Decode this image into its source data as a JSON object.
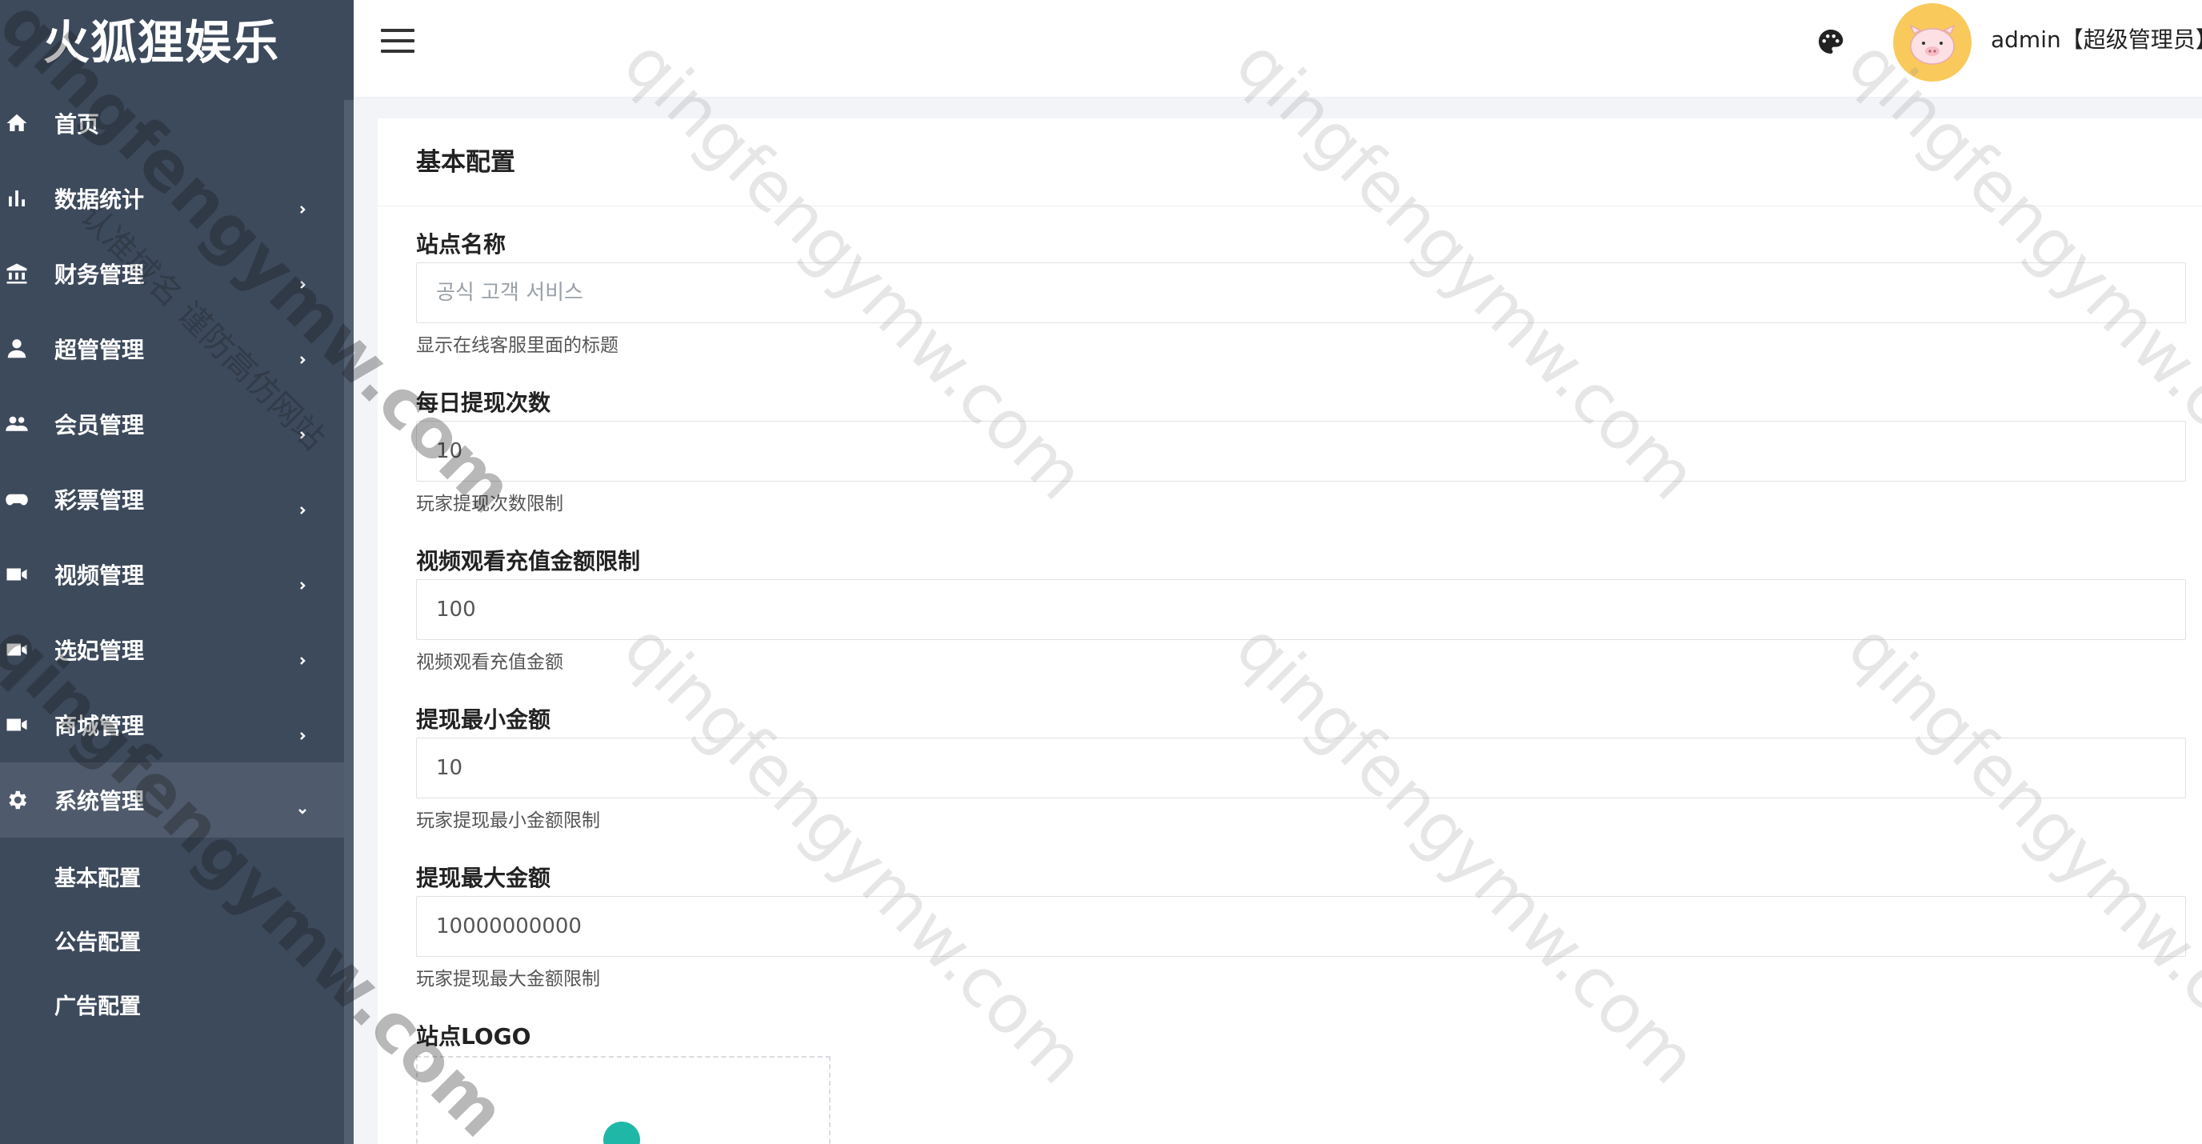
{
  "app": {
    "title": "火狐狸娱乐"
  },
  "sidebar": {
    "items": [
      {
        "label": "首页",
        "icon": "home-icon",
        "has_arrow": false
      },
      {
        "label": "数据统计",
        "icon": "bar-chart-icon",
        "has_arrow": true
      },
      {
        "label": "财务管理",
        "icon": "bank-icon",
        "has_arrow": true
      },
      {
        "label": "超管管理",
        "icon": "user-icon",
        "has_arrow": true
      },
      {
        "label": "会员管理",
        "icon": "users-icon",
        "has_arrow": true
      },
      {
        "label": "彩票管理",
        "icon": "gamepad-icon",
        "has_arrow": true
      },
      {
        "label": "视频管理",
        "icon": "video-icon",
        "has_arrow": true
      },
      {
        "label": "选妃管理",
        "icon": "video-icon",
        "has_arrow": true
      },
      {
        "label": "商城管理",
        "icon": "video-icon",
        "has_arrow": true
      },
      {
        "label": "系统管理",
        "icon": "gear-icon",
        "has_arrow": true,
        "expanded": true
      }
    ],
    "submenu": [
      {
        "label": "基本配置"
      },
      {
        "label": "公告配置"
      },
      {
        "label": "广告配置"
      }
    ]
  },
  "header": {
    "user": "admin【超级管理员】",
    "icons": [
      "hamburger-menu-icon",
      "palette-icon",
      "pig-avatar"
    ]
  },
  "main": {
    "title": "基本配置",
    "fields": [
      {
        "label": "站点名称",
        "value": "",
        "placeholder": "공식 고객 서비스",
        "help": "显示在线客服里面的标题"
      },
      {
        "label": "每日提现次数",
        "value": "10",
        "placeholder": "",
        "help": "玩家提现次数限制"
      },
      {
        "label": "视频观看充值金额限制",
        "value": "100",
        "placeholder": "",
        "help": "视频观看充值金额"
      },
      {
        "label": "提现最小金额",
        "value": "10",
        "placeholder": "",
        "help": "玩家提现最小金额限制"
      },
      {
        "label": "提现最大金额",
        "value": "10000000000",
        "placeholder": "",
        "help": "玩家提现最大金额限制"
      }
    ],
    "logo_label": "站点LOGO"
  },
  "watermarks": {
    "primary": "qingfengymw.com",
    "secondary": "qingfengymw.com",
    "chinese": "认准域名 谨防高仿网站"
  },
  "colors": {
    "sidebar_bg": "#3d4a5c",
    "sidebar_active_bg": "#4f5b6c",
    "avatar_bg": "#f9c95c",
    "upload_accent": "#1fb7a6"
  }
}
